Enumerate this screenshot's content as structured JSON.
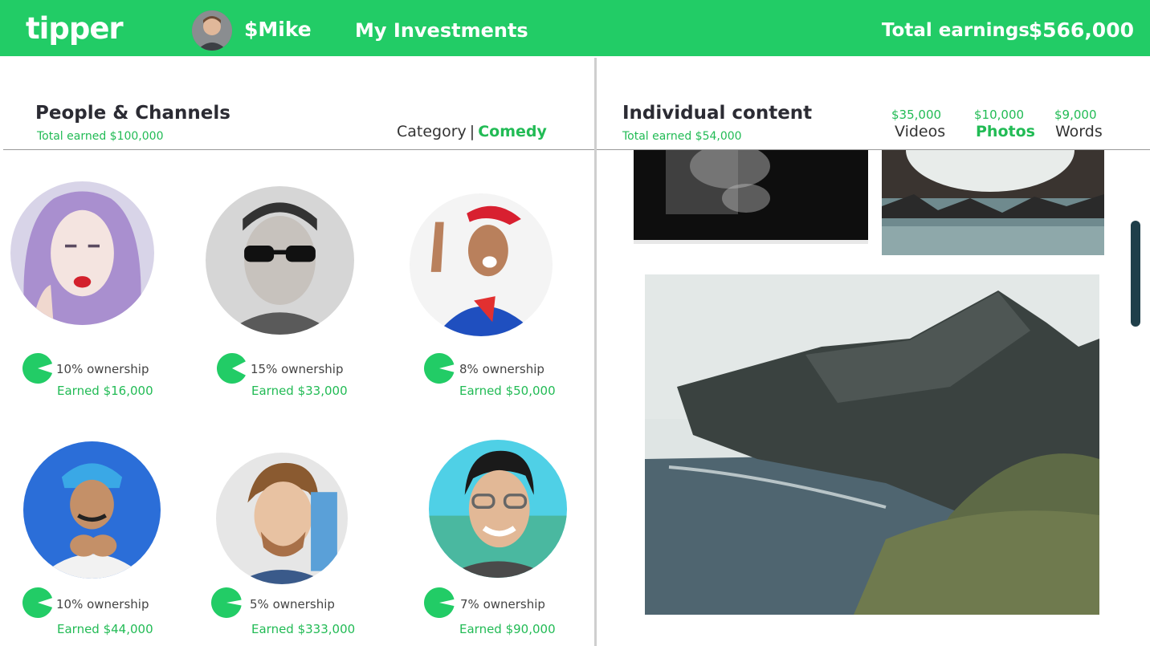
{
  "header": {
    "logo": "tipper",
    "username": "$Mike",
    "nav_investments": "My Investments",
    "total_earnings_label": "Total earnings",
    "total_earnings_value": "$566,000"
  },
  "people": {
    "title": "People & Channels",
    "subtitle": "Total earned $100,000",
    "category_label": "Category",
    "category_separator": "|",
    "category_value": "Comedy",
    "items": [
      {
        "ownership": "10% ownership",
        "earned": "Earned $16,000",
        "fraction": 0.1
      },
      {
        "ownership": "15%  ownership",
        "earned": "Earned $33,000",
        "fraction": 0.15
      },
      {
        "ownership": "8% ownership",
        "earned": "Earned $50,000",
        "fraction": 0.08
      },
      {
        "ownership": "10%  ownership",
        "earned": "Earned $44,000",
        "fraction": 0.1
      },
      {
        "ownership": "5% ownership",
        "earned": "Earned $333,000",
        "fraction": 0.05
      },
      {
        "ownership": "7% ownership",
        "earned": "Earned $90,000",
        "fraction": 0.07
      }
    ]
  },
  "content": {
    "title": "Individual content",
    "subtitle": "Total earned $54,000",
    "tabs": [
      {
        "amount": "$35,000",
        "label": "Videos",
        "active": false
      },
      {
        "amount": "$10,000",
        "label": "Photos",
        "active": true
      },
      {
        "amount": "$9,000",
        "label": "Words",
        "active": false
      }
    ]
  },
  "colors": {
    "brand_green": "#22cc66",
    "accent_green": "#22bb55",
    "text_dark": "#2b2b33"
  }
}
